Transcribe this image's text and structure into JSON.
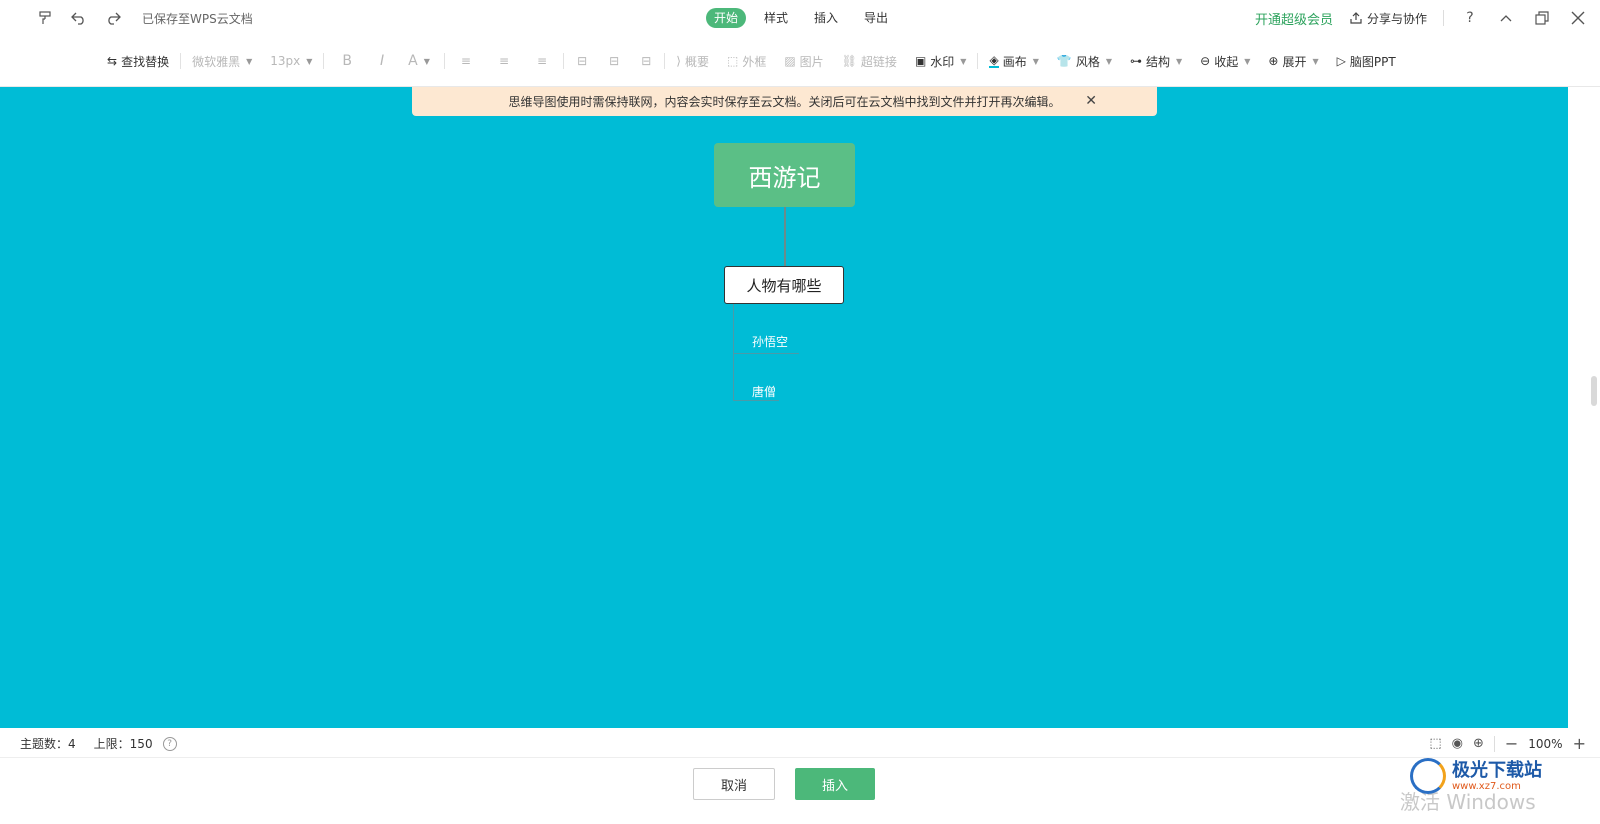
{
  "titlebar": {
    "saved_status": "已保存至WPS云文档",
    "tabs": [
      {
        "label": "开始",
        "active": true
      },
      {
        "label": "样式",
        "active": false
      },
      {
        "label": "插入",
        "active": false
      },
      {
        "label": "导出",
        "active": false
      }
    ],
    "vip_label": "开通超级会员",
    "share_label": "分享与协作",
    "help_glyph": "?",
    "accent_color": "#4cb87a"
  },
  "toolbar": {
    "find_replace": "查找替换",
    "font_family": "微软雅黑",
    "font_size": "13px",
    "bold": "B",
    "italic": "I",
    "font_color": "A",
    "summary": "概要",
    "frame": "外框",
    "image": "图片",
    "hyperlink": "超链接",
    "watermark": "水印",
    "canvas": "画布",
    "style": "风格",
    "structure": "结构",
    "collapse": "收起",
    "expand": "展开",
    "mindmap_ppt": "脑图PPT"
  },
  "notice": {
    "text": "思维导图使用时需保持联网，内容会实时保存至云文档。关闭后可在云文档中找到文件并打开再次编辑。",
    "bg_color": "#fde8d2"
  },
  "mindmap": {
    "canvas_color": "#00bcd6",
    "root": {
      "text": "西游记",
      "color": "#5bbf86"
    },
    "child": {
      "text": "人物有哪些"
    },
    "leaves": [
      "孙悟空",
      "唐僧"
    ]
  },
  "statusbar": {
    "topic_count_label": "主题数：",
    "topic_count": "4",
    "limit_label": "上限：",
    "limit": "150",
    "zoom": "100%"
  },
  "actions": {
    "cancel": "取消",
    "insert": "插入"
  },
  "watermark": {
    "activate_text": "激活 Windows",
    "logo_text": "极光下载站",
    "logo_url": "www.xz7.com"
  }
}
